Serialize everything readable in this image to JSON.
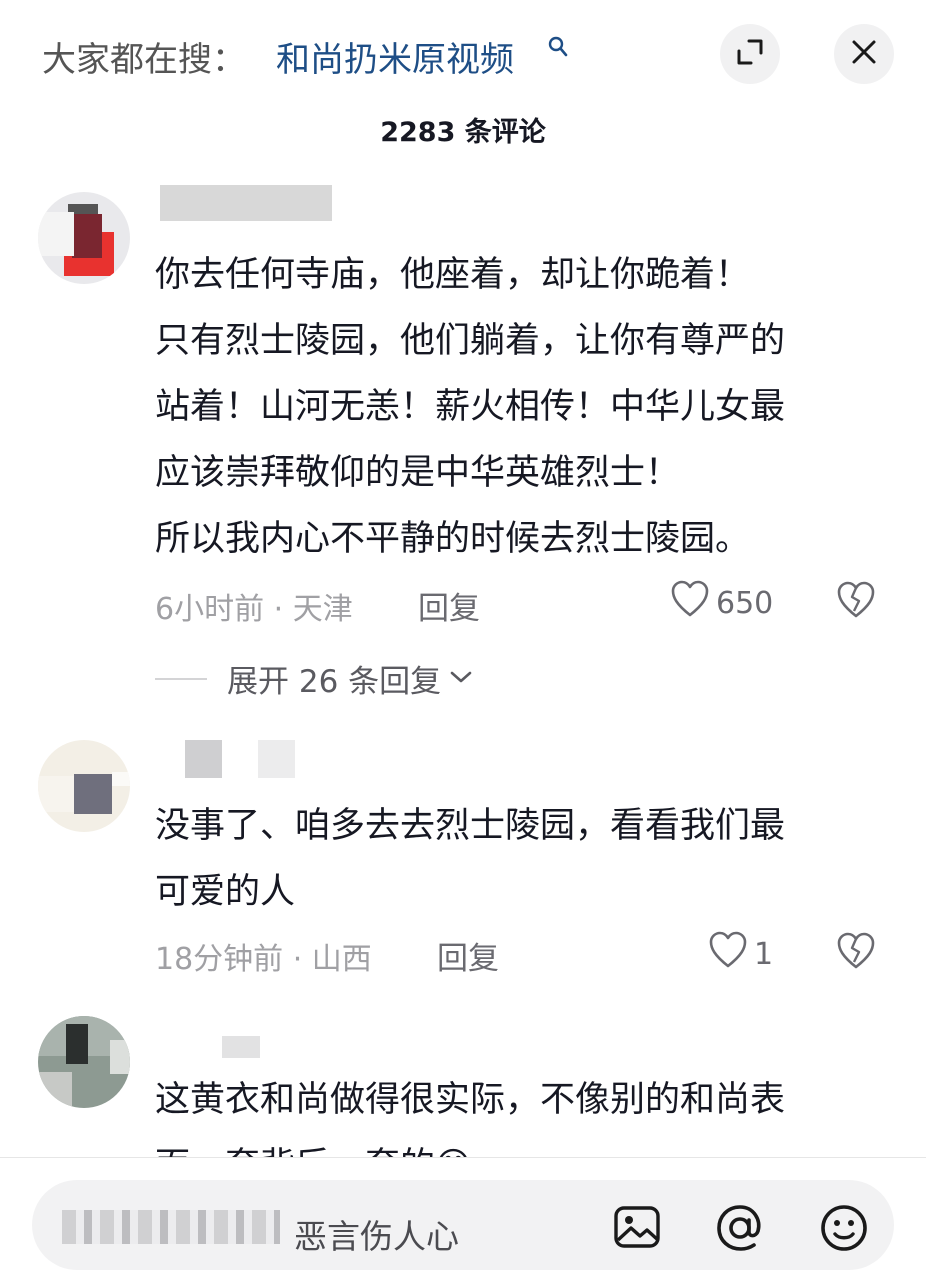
{
  "header": {
    "search_prefix": "大家都在搜：",
    "search_term": "和尚扔米原视频",
    "search_icon": "search-icon",
    "expand_icon": "expand-icon",
    "close_icon": "close-icon",
    "comment_count": "2283 条评论"
  },
  "comments": [
    {
      "lines": [
        "你去任何寺庙，他座着，却让你跪着！",
        "只有烈士陵园，他们躺着，让你有尊严的",
        "站着！山河无恙！薪火相传！中华儿女最",
        "应该崇拜敬仰的是中华英雄烈士！",
        "所以我内心不平静的时候去烈士陵园。"
      ],
      "meta": "6小时前 · 天津",
      "reply": "回复",
      "likes": "650",
      "expand_replies": "展开 26 条回复"
    },
    {
      "lines": [
        "没事了、咱多去去烈士陵园，看看我们最",
        "可爱的人"
      ],
      "meta": "18分钟前 · 山西",
      "reply": "回复",
      "likes": "1"
    },
    {
      "lines": [
        "这黄衣和尚做得很实际，不像别的和尚表",
        "面一套背后一套的😅"
      ]
    }
  ],
  "input": {
    "placeholder": "恶言伤人心",
    "image_icon": "image-icon",
    "mention_icon": "at-icon",
    "emoji_icon": "emoji-icon"
  },
  "colors": {
    "search_term": "#1e4e86",
    "meta_gray": "#a0a0a4",
    "text": "#161823"
  }
}
